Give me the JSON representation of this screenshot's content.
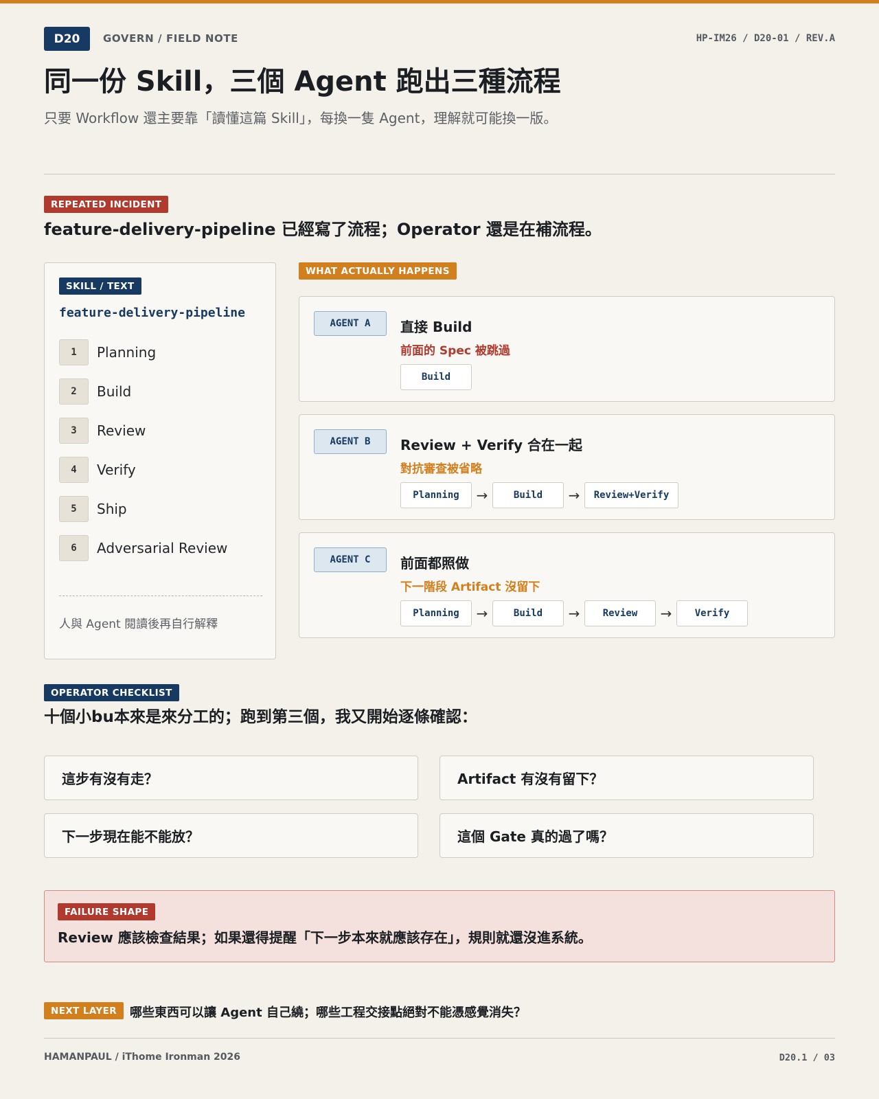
{
  "header": {
    "badge": "D20",
    "section": "GOVERN / FIELD NOTE",
    "doc_id": "HP-IM26 / D20-01 / REV.A",
    "title": "同一份 Skill，三個 Agent 跑出三種流程",
    "subtitle": "只要 Workflow 還主要靠「讀懂這篇 Skill」，每換一隻 Agent，理解就可能換一版。"
  },
  "incident": {
    "tag": "REPEATED INCIDENT",
    "headline": "feature-delivery-pipeline 已經寫了流程；Operator 還是在補流程。"
  },
  "skill": {
    "tag": "SKILL / TEXT",
    "name": "feature-delivery-pipeline",
    "steps": [
      {
        "num": "1",
        "label": "Planning"
      },
      {
        "num": "2",
        "label": "Build"
      },
      {
        "num": "3",
        "label": "Review"
      },
      {
        "num": "4",
        "label": "Verify"
      },
      {
        "num": "5",
        "label": "Ship"
      },
      {
        "num": "6",
        "label": "Adversarial Review"
      }
    ],
    "note": "人與 Agent 閱讀後再自行解釋"
  },
  "actual": {
    "tag": "WHAT ACTUALLY HAPPENS",
    "agents": [
      {
        "chip": "AGENT A",
        "title": "直接 Build",
        "note": "前面的 Spec 被跳過",
        "note_color": "#b03a2e",
        "flow": [
          "Build"
        ]
      },
      {
        "chip": "AGENT B",
        "title": "Review + Verify 合在一起",
        "note": "對抗審查被省略",
        "note_color": "#d27f1e",
        "flow": [
          "Planning",
          "Build",
          "Review+Verify"
        ]
      },
      {
        "chip": "AGENT C",
        "title": "前面都照做",
        "note": "下一階段 Artifact 沒留下",
        "note_color": "#d27f1e",
        "flow": [
          "Planning",
          "Build",
          "Review",
          "Verify"
        ]
      }
    ]
  },
  "checklist": {
    "tag": "OPERATOR CHECKLIST",
    "headline": "十個小bu本來是來分工的；跑到第三個，我又開始逐條確認：",
    "items": [
      "這步有沒有走？",
      "Artifact 有沒有留下？",
      "下一步現在能不能放？",
      "這個 Gate 真的過了嗎？"
    ]
  },
  "failure": {
    "tag": "FAILURE SHAPE",
    "text": "Review 應該檢查結果；如果還得提醒「下一步本來就應該存在」，規則就還沒進系統。"
  },
  "next": {
    "tag": "NEXT LAYER",
    "text": "哪些東西可以讓 Agent 自己繞；哪些工程交接點絕對不能憑感覺消失？"
  },
  "footer": {
    "left": "HAMANPAUL / iThome Ironman 2026",
    "right": "D20.1 / 03"
  },
  "colors": {
    "accent_orange": "#d27f1e",
    "navy": "#173a63",
    "red": "#b03a2e",
    "background": "#f3f1ea"
  }
}
